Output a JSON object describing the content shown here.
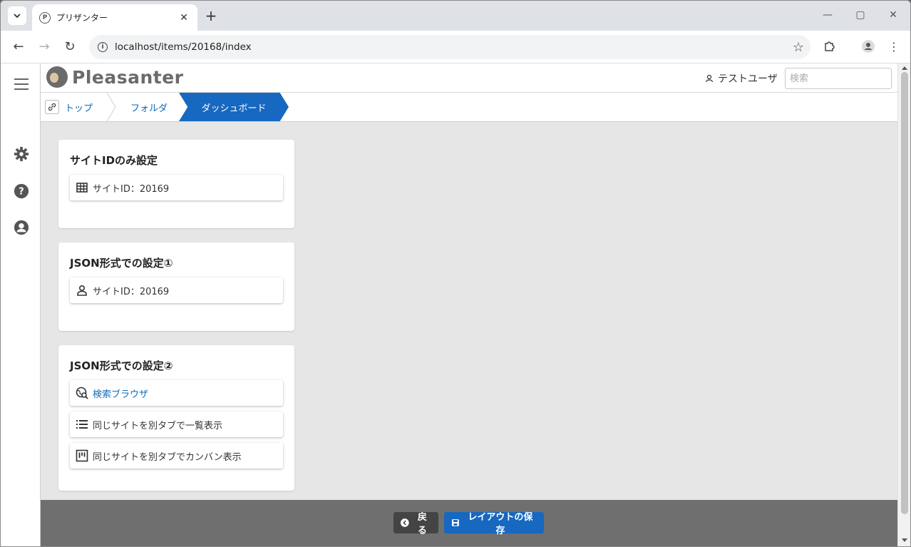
{
  "browser": {
    "tab_title": "プリザンター",
    "url": "localhost/items/20168/index",
    "favicon_letter": "P"
  },
  "app": {
    "logo_text": "Pleasanter",
    "user_name": "テストユーザ",
    "search_placeholder": "検索"
  },
  "breadcrumb": {
    "items": [
      "トップ",
      "フォルダ"
    ],
    "active": "ダッシュボード"
  },
  "cards": [
    {
      "title": "サイトIDのみ設定",
      "items": [
        {
          "label": "サイトID：20169",
          "icon": "table-grid-icon"
        }
      ]
    },
    {
      "title": "JSON形式での設定①",
      "items": [
        {
          "label": "サイトID：20169",
          "icon": "person-icon"
        }
      ]
    },
    {
      "title": "JSON形式での設定②",
      "items": [
        {
          "label": "検索ブラウザ",
          "icon": "globe-search-icon"
        },
        {
          "label": "同じサイトを別タブで一覧表示",
          "icon": "list-icon"
        },
        {
          "label": "同じサイトを別タブでカンバン表示",
          "icon": "kanban-icon"
        }
      ]
    }
  ],
  "footer": {
    "back_label": "戻る",
    "save_label": "レイアウトの保存"
  },
  "colors": {
    "accent": "#1668c0",
    "link": "#0d6bbd",
    "footer_bg": "#6f6f6f",
    "content_bg": "#e6e6e6"
  }
}
